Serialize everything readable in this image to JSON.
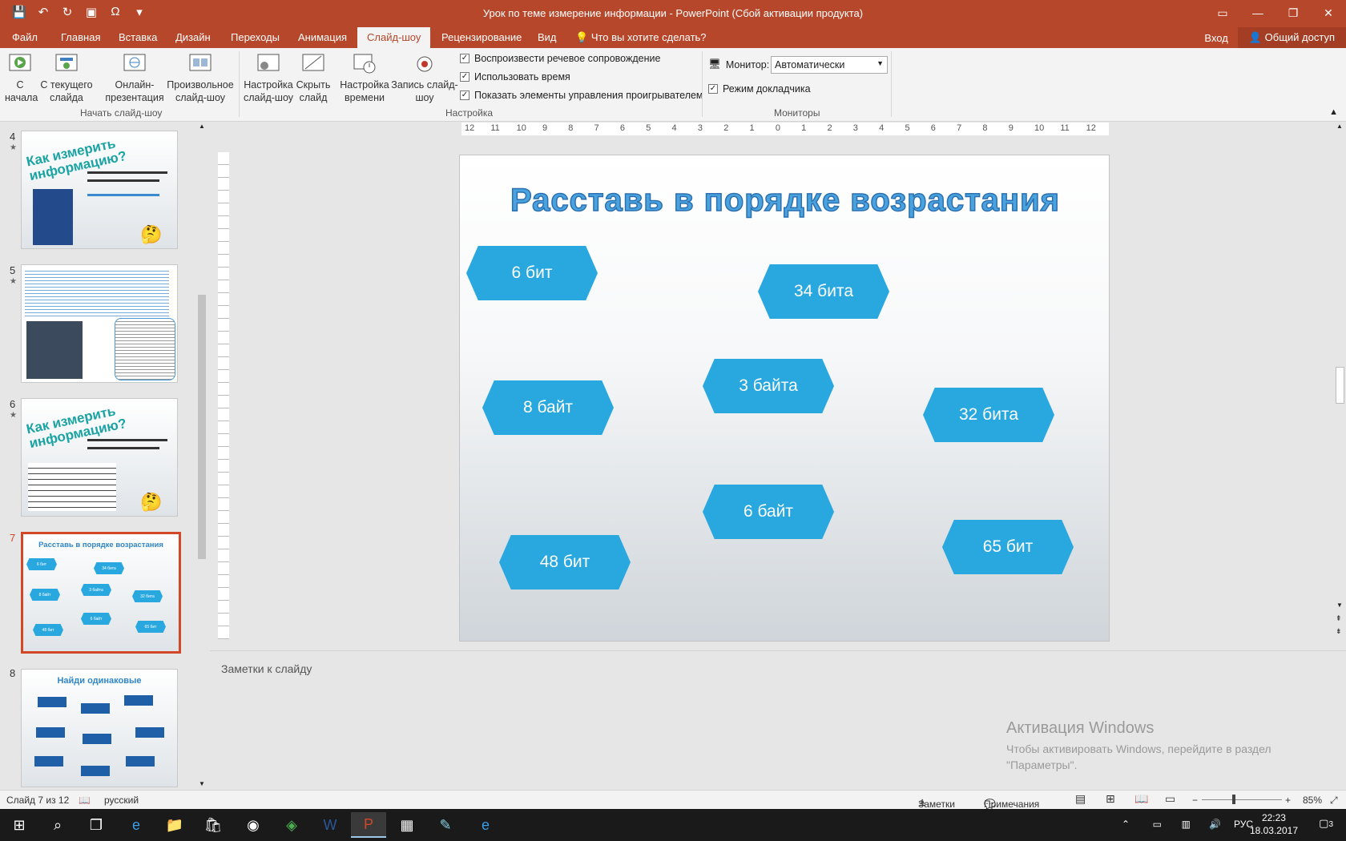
{
  "window": {
    "title": "Урок по теме измерение информации - PowerPoint (Сбой активации продукта)"
  },
  "tabs": [
    "Файл",
    "Главная",
    "Вставка",
    "Дизайн",
    "Переходы",
    "Анимация",
    "Слайд-шоу",
    "Рецензирование",
    "Вид"
  ],
  "active_tab": "Слайд-шоу",
  "tell_me": "Что вы хотите сделать?",
  "account": {
    "login": "Вход",
    "share": "Общий доступ"
  },
  "ribbon": {
    "group_start": "Начать слайд-шоу",
    "group_setup": "Настройка",
    "group_monitors": "Мониторы",
    "btn_from_start_l1": "С",
    "btn_from_start_l2": "начала",
    "btn_from_current_l1": "С текущего",
    "btn_from_current_l2": "слайда",
    "btn_online_l1": "Онлайн-",
    "btn_online_l2": "презентация",
    "btn_custom_l1": "Произвольное",
    "btn_custom_l2": "слайд-шоу",
    "btn_setup_l1": "Настройка",
    "btn_setup_l2": "слайд-шоу",
    "btn_hide_l1": "Скрыть",
    "btn_hide_l2": "слайд",
    "btn_rehearse_l1": "Настройка",
    "btn_rehearse_l2": "времени",
    "btn_record_l1": "Запись слайд-",
    "btn_record_l2": "шоу",
    "chk_narration": "Воспроизвести речевое сопровождение",
    "chk_timings": "Использовать время",
    "chk_media": "Показать элементы управления проигрывателем",
    "monitor_label": "Монитор:",
    "monitor_value": "Автоматически",
    "presenter_view": "Режим докладчика"
  },
  "thumbnails": [
    {
      "num": "4",
      "title": "Как измерить информацию?"
    },
    {
      "num": "5"
    },
    {
      "num": "6",
      "title": "Как измерить информацию?"
    },
    {
      "num": "7",
      "title": "Расставь в порядке возрастания"
    },
    {
      "num": "8",
      "title": "Найди одинаковые"
    }
  ],
  "ruler": [
    "12",
    "11",
    "10",
    "9",
    "8",
    "7",
    "6",
    "5",
    "4",
    "3",
    "2",
    "1",
    "0",
    "1",
    "2",
    "3",
    "4",
    "5",
    "6",
    "7",
    "8",
    "9",
    "10",
    "11",
    "12"
  ],
  "slide": {
    "title": "Расставь в порядке возрастания",
    "items": [
      "6 бит",
      "34 бита",
      "8 байт",
      "3 байта",
      "32  бита",
      "6 байт",
      "48 бит",
      "65 бит"
    ]
  },
  "notes_placeholder": "Заметки к слайду",
  "activation": {
    "line1": "Активация Windows",
    "line2": "Чтобы активировать Windows, перейдите в раздел",
    "line3": "\"Параметры\"."
  },
  "status": {
    "slide_of": "Слайд 7 из 12",
    "language": "русский",
    "notes": "Заметки",
    "comments": "Примечания",
    "zoom": "85%"
  },
  "taskbar": {
    "lang": "РУС",
    "time": "22:23",
    "date": "18.03.2017",
    "notif_count": "3"
  }
}
